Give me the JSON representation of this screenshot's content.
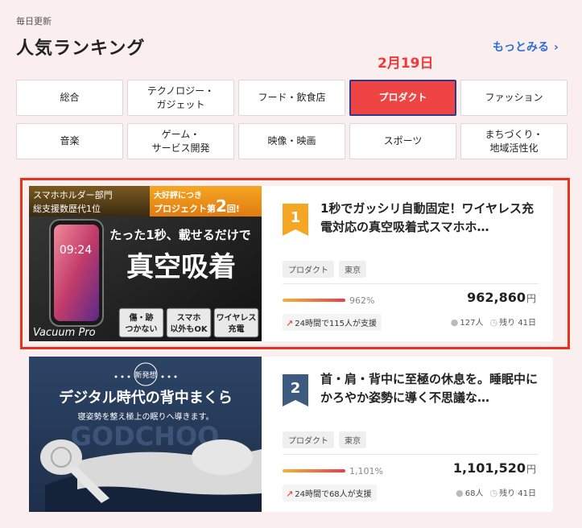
{
  "header": {
    "daily_label": "毎日更新",
    "title": "人気ランキング",
    "more_label": "もっとみる",
    "date": "2月19日"
  },
  "categories": [
    {
      "label": "総合",
      "active": false
    },
    {
      "label": "テクノロジー・\nガジェット",
      "active": false
    },
    {
      "label": "フード・飲食店",
      "active": false
    },
    {
      "label": "プロダクト",
      "active": true
    },
    {
      "label": "ファッション",
      "active": false
    },
    {
      "label": "音楽",
      "active": false
    },
    {
      "label": "ゲーム・\nサービス開発",
      "active": false
    },
    {
      "label": "映像・映画",
      "active": false
    },
    {
      "label": "スポーツ",
      "active": false
    },
    {
      "label": "まちづくり・\n地域活性化",
      "active": false
    }
  ],
  "items": [
    {
      "rank": "1",
      "title": "1秒でガッシリ自動固定！ワイヤレス充電対応の真空吸着式スマホホ…",
      "tags": [
        "プロダクト",
        "東京"
      ],
      "percent_label": "962%",
      "amount": "962,860",
      "currency": "円",
      "support": "24時間で115人が支援",
      "supporters": "127人",
      "remaining": "残り 41日",
      "image_text": {
        "top_left": "スマホホルダー部門\n総支援数歴代1位",
        "top_right_prefix": "大好評につき\nプロジェクト第",
        "top_right_num": "2",
        "top_right_suffix": "回!",
        "phone_time": "09:24",
        "line1": "たった1秒、載せるだけで",
        "line2": "真空吸着",
        "brand": "Vacuum Pro",
        "chip1": "傷・跡\nつかない",
        "chip2": "スマホ\n以外もOK",
        "chip3": "ワイヤレス\n充電"
      }
    },
    {
      "rank": "2",
      "title": "首・肩・背中に至極の休息を。睡眠中にかろやか姿勢に導く不思議な…",
      "tags": [
        "プロダクト",
        "東京"
      ],
      "percent_label": "1,101%",
      "amount": "1,101,520",
      "currency": "円",
      "support": "24時間で68人が支援",
      "supporters": "68人",
      "remaining": "残り 41日",
      "image_text": {
        "badge": "新発想",
        "line1": "デジタル時代の背中まくら",
        "line2": "寝姿勢を整え極上の眠りへ導きます。",
        "watermark": "GODCHOO"
      }
    }
  ],
  "colors": {
    "accent": "#ee4444",
    "link": "#2b6fd6",
    "rank1": "#f5a623",
    "rank2": "#3d5a80",
    "highlight": "#e8321e"
  }
}
